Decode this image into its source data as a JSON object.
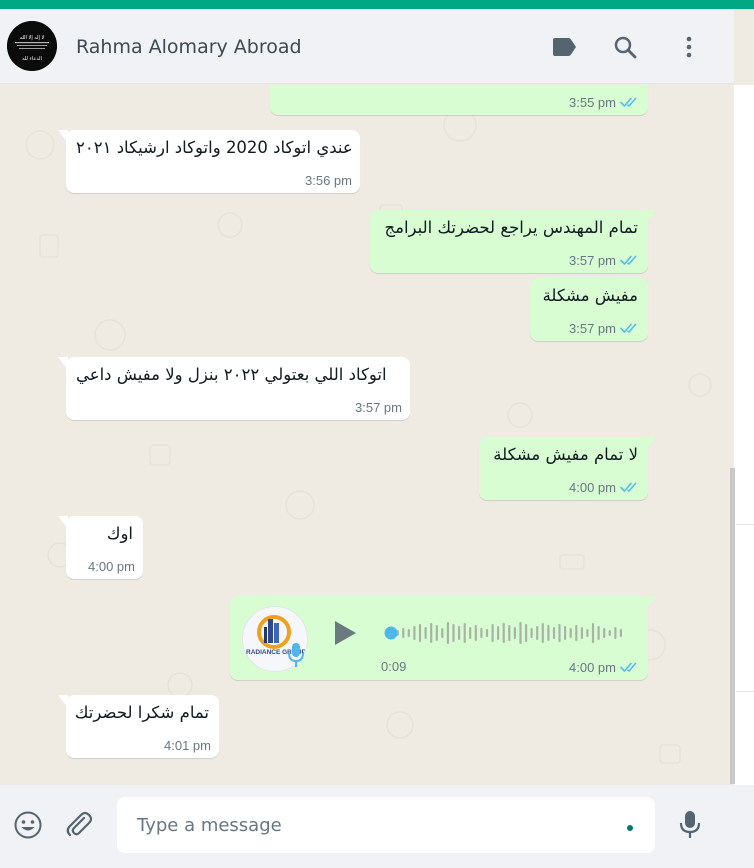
{
  "window": {
    "accent_color": "#00a884"
  },
  "header": {
    "contact_name": "Rahma Alomary Abroad",
    "avatar": {
      "text_line_1": "لا إله إلا الله",
      "text_line_2": "الدعاء لله"
    },
    "icons": [
      "label-icon",
      "search-icon",
      "menu-icon"
    ]
  },
  "messages": [
    {
      "direction": "out",
      "text": "",
      "time": "3:55 pm",
      "status": "read"
    },
    {
      "direction": "in",
      "text": "عندي اتوكاد 2020 واتوكاد ارشيكاد ٢٠٢١",
      "time": "3:56 pm"
    },
    {
      "direction": "out",
      "text": "تمام المهندس يراجع لحضرتك البرامج",
      "time": "3:57 pm",
      "status": "read"
    },
    {
      "direction": "out",
      "text": "مفيش مشكلة",
      "time": "3:57 pm",
      "status": "read"
    },
    {
      "direction": "in",
      "text": "اتوكاد اللي بعتولي ٢٠٢٢ بنزل ولا مفيش داعي",
      "time": "3:57 pm"
    },
    {
      "direction": "out",
      "text": "لا تمام مفيش مشكلة",
      "time": "4:00 pm",
      "status": "read"
    },
    {
      "direction": "in",
      "text": "اوك",
      "time": "4:00 pm"
    },
    {
      "direction": "out",
      "type": "voice",
      "duration": "0:09",
      "time": "4:00 pm",
      "status": "read",
      "avatar_text": "RADIANCE GROUP",
      "progress": 0
    },
    {
      "direction": "in",
      "text": "تمام شكرا لحضرتك",
      "time": "4:01 pm"
    }
  ],
  "composer": {
    "placeholder": "Type a message",
    "icons": [
      "emoji-icon",
      "attach-icon",
      "microphone-icon"
    ]
  },
  "colors": {
    "incoming_bubble": "#ffffff",
    "outgoing_bubble": "#d9fdd3",
    "read_tick": "#53bdeb",
    "background": "#efeae2"
  }
}
